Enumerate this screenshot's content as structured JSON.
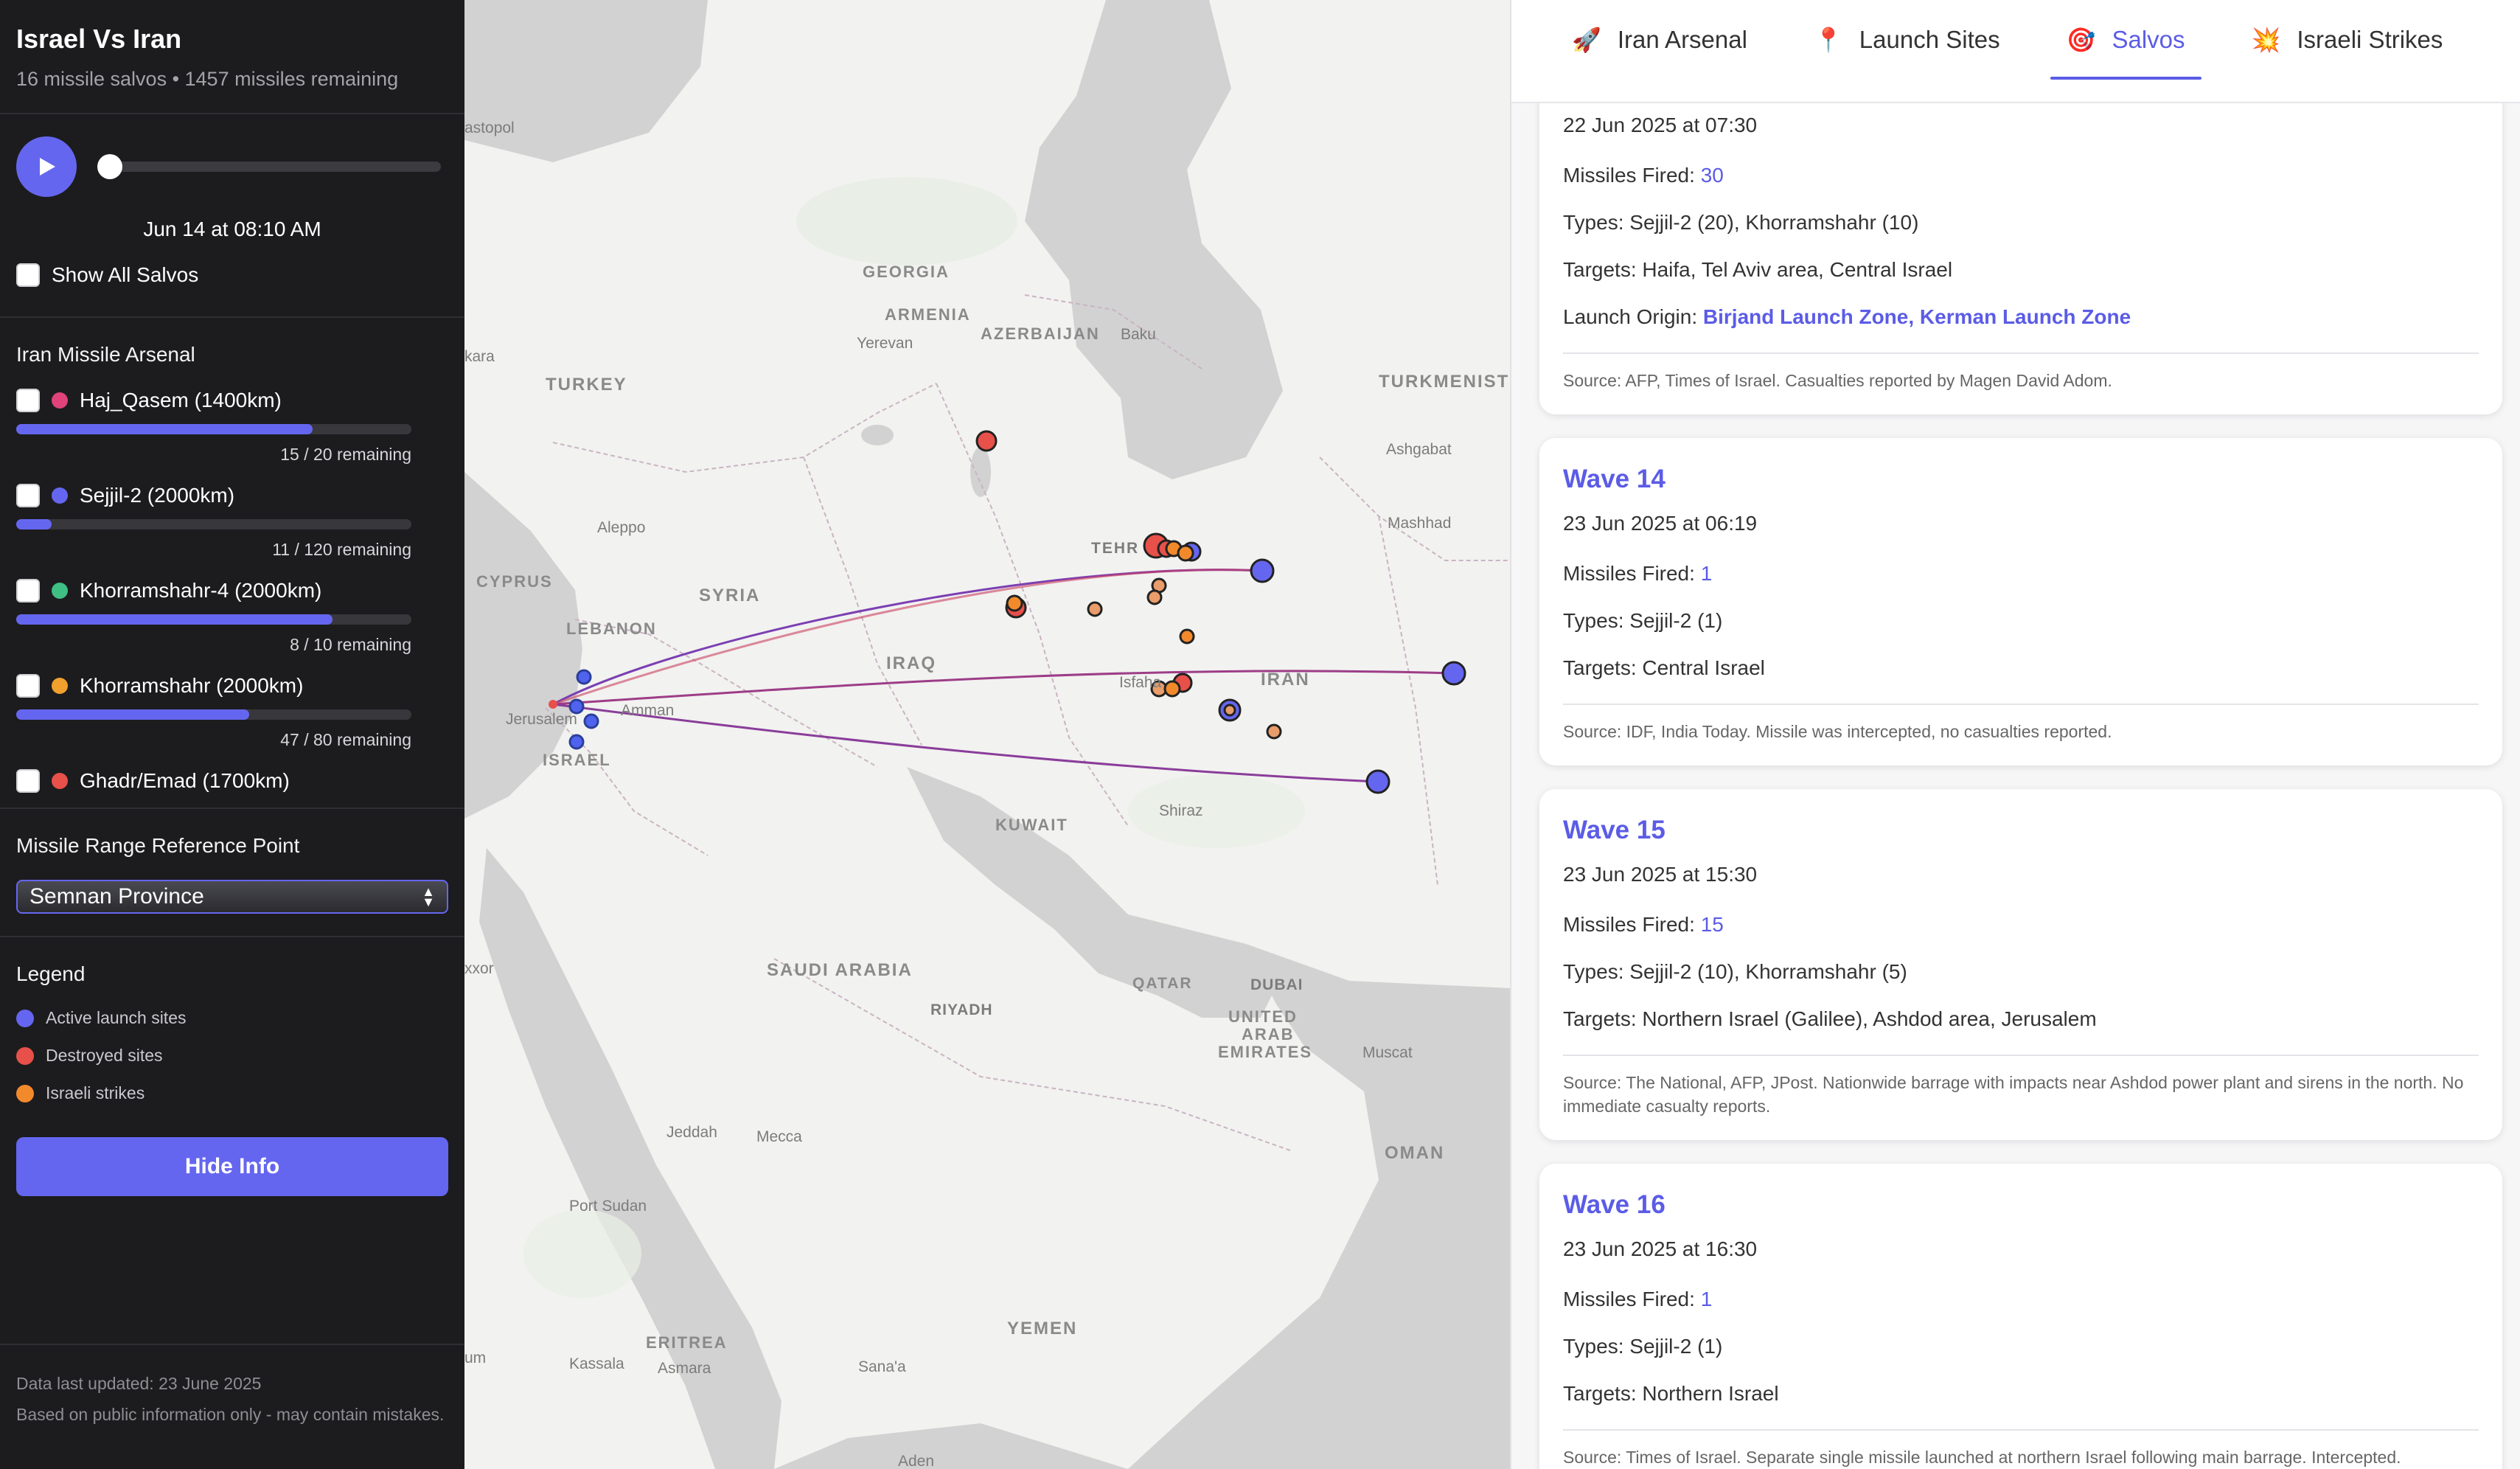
{
  "app": {
    "title": "Israel Vs Iran",
    "subtitle": "16 missile salvos • 1457 missiles remaining"
  },
  "player": {
    "time_label": "Jun 14 at 08:10 AM",
    "show_all_label": "Show All Salvos"
  },
  "arsenal": {
    "title": "Iran Missile Arsenal",
    "items": [
      {
        "label": "Haj_Qasem (1400km)",
        "color": "#e0427a",
        "remaining": "15 / 20 remaining",
        "fill": 0.75
      },
      {
        "label": "Sejjil-2 (2000km)",
        "color": "#6566ef",
        "remaining": "11 / 120 remaining",
        "fill": 0.09
      },
      {
        "label": "Khorramshahr-4 (2000km)",
        "color": "#3fbf83",
        "remaining": "8 / 10 remaining",
        "fill": 0.8
      },
      {
        "label": "Khorramshahr (2000km)",
        "color": "#f0a02c",
        "remaining": "47 / 80 remaining",
        "fill": 0.59
      },
      {
        "label": "Ghadr/Emad (1700km)",
        "color": "#e8504a"
      }
    ]
  },
  "range": {
    "title": "Missile Range Reference Point",
    "selected": "Semnan Province"
  },
  "legend": {
    "title": "Legend",
    "items": [
      {
        "label": "Active launch sites",
        "color": "#6566ef"
      },
      {
        "label": "Destroyed sites",
        "color": "#e8504a"
      },
      {
        "label": "Israeli strikes",
        "color": "#f28a2c"
      }
    ]
  },
  "hide_button": "Hide Info",
  "footer": {
    "updated": "Data last updated: 23 June 2025",
    "disclaimer": "Based on public information only - may contain mistakes."
  },
  "map": {
    "countries": {
      "turkey": "TURKEY",
      "georgia": "GEORGIA",
      "armenia": "ARMENIA",
      "azerbaijan": "AZERBAIJAN",
      "turkmenistan": "TURKMENIST",
      "syria": "SYRIA",
      "lebanon": "LEBANON",
      "cyprus": "CYPRUS",
      "israel": "ISRAEL",
      "iraq": "IRAQ",
      "iran": "IRAN",
      "kuwait": "KUWAIT",
      "saudi": "SAUDI ARABIA",
      "qatar": "QATAR",
      "uae1": "UNITED",
      "uae2": "ARAB",
      "uae3": "EMIRATES",
      "oman": "OMAN",
      "yemen": "YEMEN",
      "eritrea": "ERITREA"
    },
    "cities": {
      "sevastopol": "astopol",
      "ankara": "kara",
      "yerevan": "Yerevan",
      "baku": "Baku",
      "ashgabat": "Ashgabat",
      "mashhad": "Mashhad",
      "aleppo": "Aleppo",
      "tehran": "TEHR",
      "amman": "Amman",
      "jerusalem": "Jerusalem",
      "isfahan": "Isfaha",
      "shiraz": "Shiraz",
      "riyadh": "RIYADH",
      "doha": "DUBAI",
      "muscat": "Muscat",
      "jeddah": "Jeddah",
      "mecca": "Mecca",
      "portsudan": "Port Sudan",
      "kassala": "Kassala",
      "asmara": "Asmara",
      "sanaa": "Sana'a",
      "aden": "Aden",
      "cairo": "xxor",
      "khartoum": "um"
    }
  },
  "tabs": [
    {
      "label": "Iran Arsenal",
      "icon": "rocket-icon",
      "glyph": "🚀"
    },
    {
      "label": "Launch Sites",
      "icon": "pin-icon",
      "glyph": "📍"
    },
    {
      "label": "Salvos",
      "icon": "target-icon",
      "glyph": "🎯"
    },
    {
      "label": "Israeli Strikes",
      "icon": "explosion-icon",
      "glyph": "💥"
    }
  ],
  "salvos": [
    {
      "date": "22 Jun 2025 at 07:30",
      "missiles_label": "Missiles Fired: ",
      "missiles": "30",
      "types": "Types: Sejjil-2 (20), Khorramshahr (10)",
      "targets": "Targets: Haifa, Tel Aviv area, Central Israel",
      "origin_label": "Launch Origin: ",
      "origin": "Birjand Launch Zone, Kerman Launch Zone",
      "source": "Source: AFP, Times of Israel. Casualties reported by Magen David Adom."
    },
    {
      "title": "Wave 14",
      "date": "23 Jun 2025 at 06:19",
      "missiles_label": "Missiles Fired: ",
      "missiles": "1",
      "types": "Types: Sejjil-2 (1)",
      "targets": "Targets: Central Israel",
      "source": "Source: IDF, India Today. Missile was intercepted, no casualties reported."
    },
    {
      "title": "Wave 15",
      "date": "23 Jun 2025 at 15:30",
      "missiles_label": "Missiles Fired: ",
      "missiles": "15",
      "types": "Types: Sejjil-2 (10), Khorramshahr (5)",
      "targets": "Targets: Northern Israel (Galilee), Ashdod area, Jerusalem",
      "source": "Source: The National, AFP, JPost. Nationwide barrage with impacts near Ashdod power plant and sirens in the north. No immediate casualty reports."
    },
    {
      "title": "Wave 16",
      "date": "23 Jun 2025 at 16:30",
      "missiles_label": "Missiles Fired: ",
      "missiles": "1",
      "types": "Types: Sejjil-2 (1)",
      "targets": "Targets: Northern Israel",
      "source": "Source: Times of Israel. Separate single missile launched at northern Israel following main barrage. Intercepted."
    }
  ]
}
